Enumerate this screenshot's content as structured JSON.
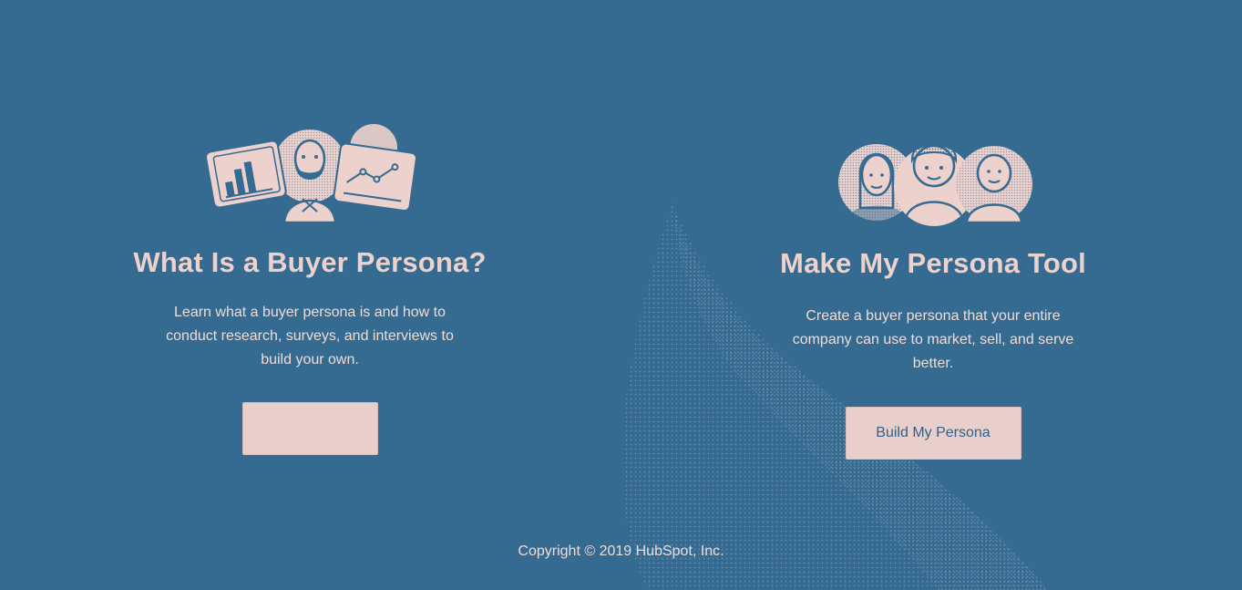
{
  "left_card": {
    "title": "What Is a Buyer Persona?",
    "description": "Learn what a buyer persona is and how to conduct research, surveys, and interviews to build your own.",
    "button_label": ""
  },
  "right_card": {
    "title": "Make My Persona Tool",
    "description": "Create a buyer persona that your entire company can use to market, sell, and serve better.",
    "button_label": "Build My Persona"
  },
  "footer": {
    "copyright": "Copyright © 2019 HubSpot, Inc."
  },
  "colors": {
    "background": "#356a91",
    "accent": "#ecd1cc",
    "button_text": "#2e6288"
  },
  "icons": {
    "left": "persona-research-illustration",
    "right": "persona-group-illustration"
  }
}
